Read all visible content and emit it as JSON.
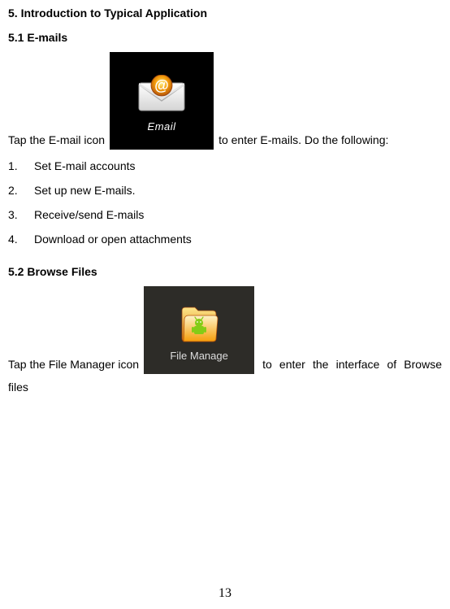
{
  "heading_5": "5. Introduction to Typical Application",
  "heading_5_1": "5.1 E-mails",
  "email_line_before": "Tap the E-mail icon",
  "email_line_after": "to enter E-mails. Do the following:",
  "email_icon_label": "Email",
  "steps": [
    {
      "num": "1.",
      "text": "Set E-mail accounts"
    },
    {
      "num": "2.",
      "text": "Set up new E-mails."
    },
    {
      "num": "3.",
      "text": "Receive/send E-mails"
    },
    {
      "num": "4.",
      "text": "Download or open attachments"
    }
  ],
  "heading_5_2": "5.2 Browse Files",
  "file_line_before": "Tap the File Manager icon",
  "file_line_after": "to enter the interface of Browse",
  "file_icon_label": "File Manage",
  "file_line_continued": "files",
  "page_number": "13"
}
